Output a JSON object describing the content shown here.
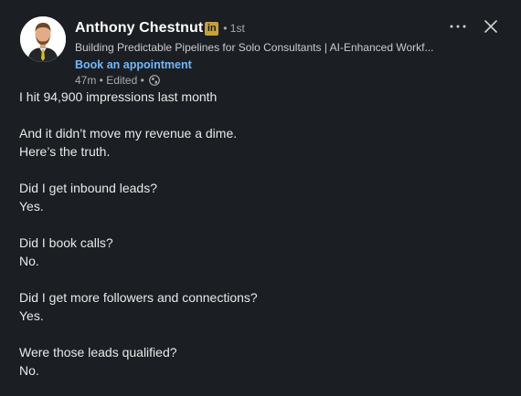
{
  "post": {
    "author": {
      "name": "Anthony Chestnut",
      "badge": "in",
      "degree": "• 1st",
      "headline": "Building Predictable Pipelines for Solo Consultants | AI-Enhanced Workf...",
      "cta": "Book an appointment",
      "timestamp": "47m • Edited •",
      "visibility_icon": "globe-icon"
    },
    "actions": {
      "more_icon": "more-horizontal-icon",
      "close_icon": "close-icon"
    },
    "body": {
      "p1": "I hit 94,900 impressions last month",
      "p2a": "And it didn’t move my revenue a dime.",
      "p2b": "Here’s the truth.",
      "q1": "Did I get inbound leads?",
      "a1": "Yes.",
      "q2": "Did I book calls?",
      "a2": "No.",
      "q3": "Did I get more followers and connections?",
      "a3": "Yes.",
      "q4": "Were those leads qualified?",
      "a4": "No."
    }
  },
  "colors": {
    "background": "#1b1f23",
    "link": "#71b7fb",
    "badge": "#c7a03c"
  }
}
